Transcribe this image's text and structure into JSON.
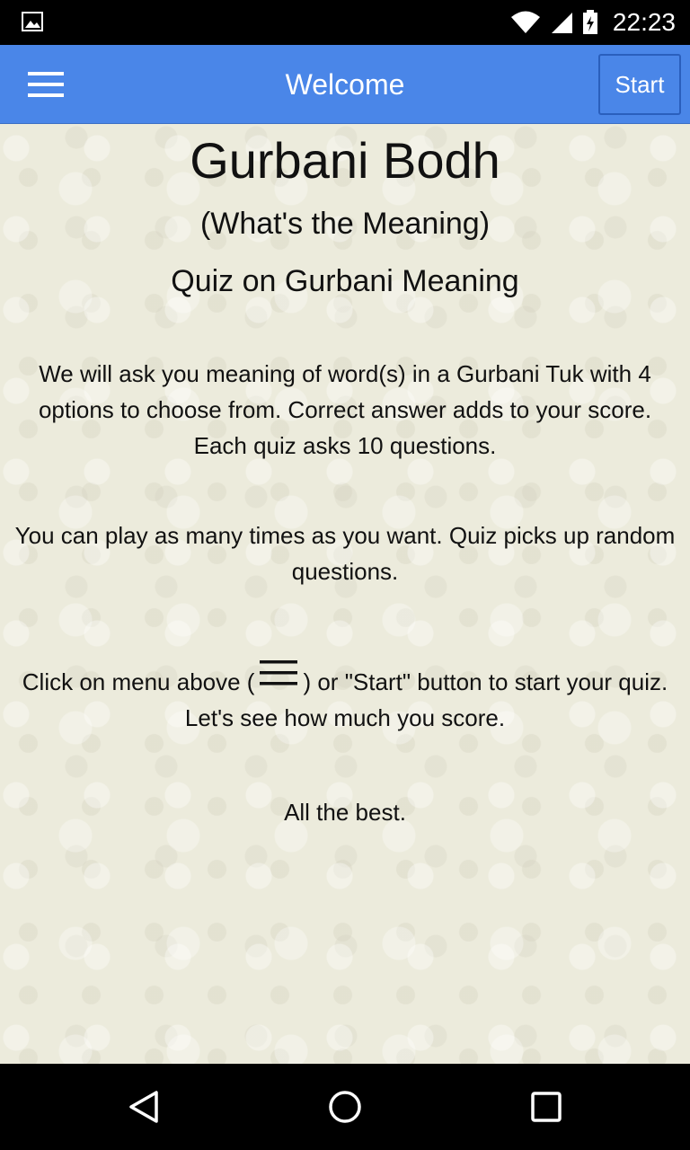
{
  "status_bar": {
    "time": "22:23",
    "icons": [
      "image-icon",
      "wifi-icon",
      "signal-icon",
      "battery-icon"
    ]
  },
  "app_bar": {
    "title": "Welcome",
    "start_label": "Start",
    "menu_icon": "hamburger-menu-icon",
    "color": "#4a86e8"
  },
  "main": {
    "title": "Gurbani Bodh",
    "subtitle": "(What's the Meaning)",
    "tagline": "Quiz on Gurbani Meaning",
    "paragraph1": "We will ask you meaning of word(s) in a Gurbani Tuk with 4 options to choose from. Correct answer adds to your score. Each quiz asks 10 questions.",
    "paragraph2": "You can play as many times as you want. Quiz picks up random questions.",
    "paragraph3_before": "Click on menu above (",
    "paragraph3_after": ") or \"Start\" button to start your quiz. Let's see how much you score.",
    "paragraph4": "All the best."
  },
  "nav_bar": {
    "buttons": [
      "back-icon",
      "home-icon",
      "recents-icon"
    ]
  }
}
